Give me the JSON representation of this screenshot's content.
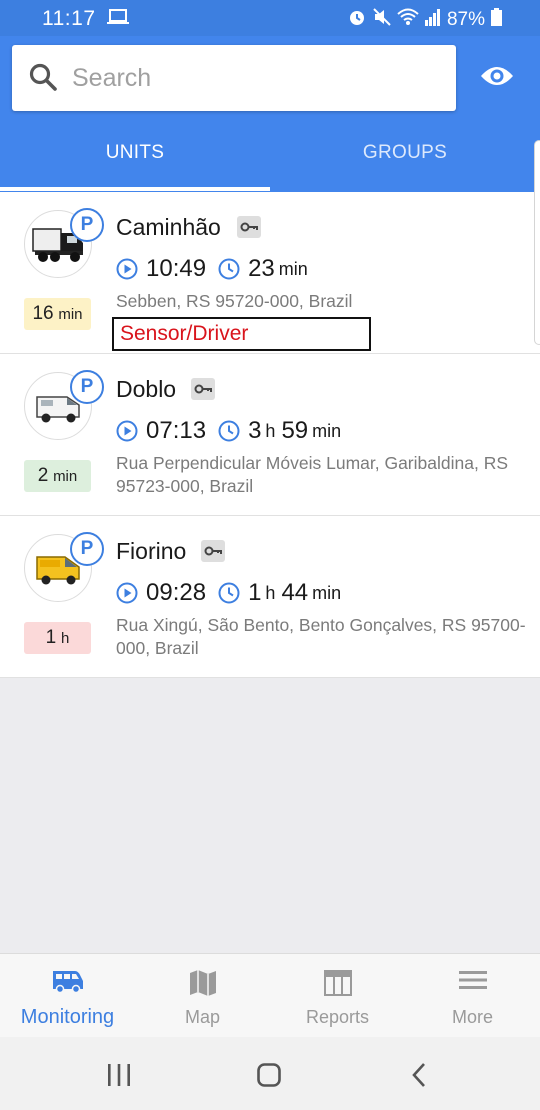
{
  "status_bar": {
    "time": "11:17",
    "battery": "87%",
    "icons": [
      "laptop-icon",
      "alarm-icon",
      "mute-icon",
      "wifi-icon",
      "signal-icon",
      "battery-icon"
    ]
  },
  "search": {
    "placeholder": "Search",
    "value": ""
  },
  "tabs": [
    {
      "label": "UNITS",
      "selected": true
    },
    {
      "label": "GROUPS",
      "selected": false
    }
  ],
  "units": [
    {
      "name": "Caminhão",
      "vehicle_icon": "truck",
      "status": "P",
      "age_value": "16",
      "age_unit": "min",
      "age_color": "#fdf2c6",
      "time": "10:49",
      "duration_h": "",
      "duration_h_unit": "",
      "duration_m": "23",
      "duration_m_unit": "min",
      "address": "Sebben, RS 95720-000, Brazil",
      "sensor_label": "Sensor/Driver"
    },
    {
      "name": "Doblo",
      "vehicle_icon": "van",
      "status": "P",
      "age_value": "2",
      "age_unit": "min",
      "age_color": "#ddefdd",
      "time": "07:13",
      "duration_h": "3",
      "duration_h_unit": "h",
      "duration_m": "59",
      "duration_m_unit": "min",
      "address": "Rua Perpendicular Móveis Lumar, Garibaldina, RS 95723-000, Brazil"
    },
    {
      "name": "Fiorino",
      "vehicle_icon": "van-yellow",
      "status": "P",
      "age_value": "1",
      "age_unit": "h",
      "age_color": "#fbd9d9",
      "time": "09:28",
      "duration_h": "1",
      "duration_h_unit": "h",
      "duration_m": "44",
      "duration_m_unit": "min",
      "address": "Rua Xingú, São Bento, Bento Gonçalves, RS 95700-000, Brazil"
    }
  ],
  "bottom_nav": [
    {
      "label": "Monitoring",
      "icon": "van-icon",
      "active": true
    },
    {
      "label": "Map",
      "icon": "map-icon",
      "active": false
    },
    {
      "label": "Reports",
      "icon": "reports-icon",
      "active": false
    },
    {
      "label": "More",
      "icon": "menu-icon",
      "active": false
    }
  ],
  "colors": {
    "primary": "#4285ec",
    "accent": "#3d7fe0",
    "sensor_text": "#d9141c"
  }
}
